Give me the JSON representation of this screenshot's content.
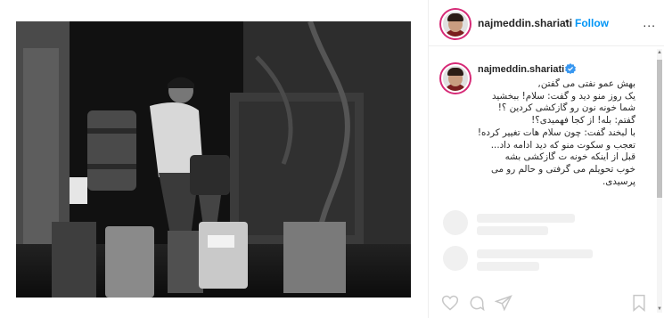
{
  "post": {
    "image_alt": "",
    "header": {
      "username": "najmeddin.shariati",
      "separator": "•",
      "follow_label": "Follow",
      "more_label": "..."
    },
    "caption": {
      "username": "najmeddin.shariati",
      "verified_icon": "verified-badge-icon",
      "lines": [
        "بهش عمو نفتی می گفتن,",
        "یک روز منو دید و گفت: سلام! ببخشید",
        "شما خونه نون رو گازکشی کردین ؟!",
        "گفتم: بله! از کجا فهمیدی؟!",
        "با لبخند گفت: چون سلام هات تغییر کرده!",
        "تعجب و سکوت منو که دید ادامه داد...",
        "قبل از اینکه خونه ت گازکشی بشه",
        "خوب تحویلم می گرفتی و حالم رو می",
        "پرسیدی."
      ]
    },
    "colors": {
      "accent": "#0095f6",
      "text": "#262626",
      "border": "#efefef",
      "skeleton": "#f0f0f0",
      "avatar_ring": "#d62976"
    }
  },
  "icons": [
    "heart-icon",
    "comment-icon",
    "share-icon",
    "bookmark-icon"
  ]
}
